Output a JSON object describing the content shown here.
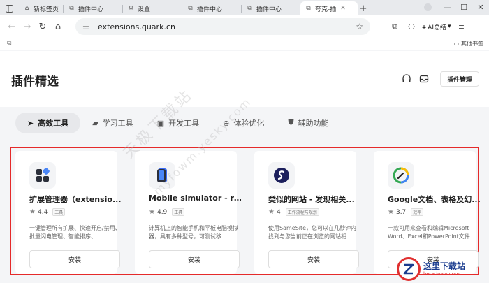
{
  "tabs": [
    {
      "label": "",
      "icon": "sidebar-icon"
    },
    {
      "label": "新标签页",
      "icon": "home-icon"
    },
    {
      "label": "插件中心",
      "icon": "puzzle-icon"
    },
    {
      "label": "设置",
      "icon": "gear-icon"
    },
    {
      "label": "插件中心",
      "icon": "puzzle-icon"
    },
    {
      "label": "插件中心",
      "icon": "puzzle-icon"
    },
    {
      "label": "夸克-插",
      "icon": "puzzle-icon",
      "active": true
    }
  ],
  "toolbar": {
    "url": "extensions.quark.cn",
    "ai_label": "AI总结"
  },
  "bookmarks": {
    "other_label": "其他书签"
  },
  "header": {
    "title": "插件精选",
    "manage_label": "插件管理"
  },
  "categories": [
    {
      "label": "高效工具",
      "icon": "send-icon",
      "active": true
    },
    {
      "label": "学习工具",
      "icon": "book-icon"
    },
    {
      "label": "开发工具",
      "icon": "code-icon"
    },
    {
      "label": "体验优化",
      "icon": "plus-circle-icon"
    },
    {
      "label": "辅助功能",
      "icon": "shield-icon"
    }
  ],
  "cards": [
    {
      "name": "扩展管理器（extensio...",
      "rating": "4.4",
      "tag": "工具",
      "desc": "一键管理所有扩展、快速开启/禁用、批量闪电管理、智能排序、...",
      "install": "安装"
    },
    {
      "name": "Mobile simulator - re...",
      "rating": "4.9",
      "tag": "工具",
      "desc": "计算机上的智能手机和平板电脑模拟器，具有多种型号，可测试移...",
      "install": "安装"
    },
    {
      "name": "类似的网站 - 发现相关...",
      "rating": "4",
      "tag": "工作流程与规划",
      "desc": "使用SameSite，您可以在几秒钟内找到与您当前正在浏览的网站相...",
      "install": "安装"
    },
    {
      "name": "Google文档、表格及幻...",
      "rating": "3.7",
      "tag": "效率",
      "desc": "一款可用来查看和编辑Microsoft Word、Excel和PowerPoint文件...",
      "install": "安装"
    }
  ],
  "watermark": {
    "text": "天极下载站",
    "url": "myfowm.yesky.com"
  },
  "site_logo": {
    "cn": "这里下载站",
    "en": "heredown.com"
  },
  "colors": {
    "highlight_border": "#e52a2a",
    "quark_blue": "#3b6cf6"
  }
}
